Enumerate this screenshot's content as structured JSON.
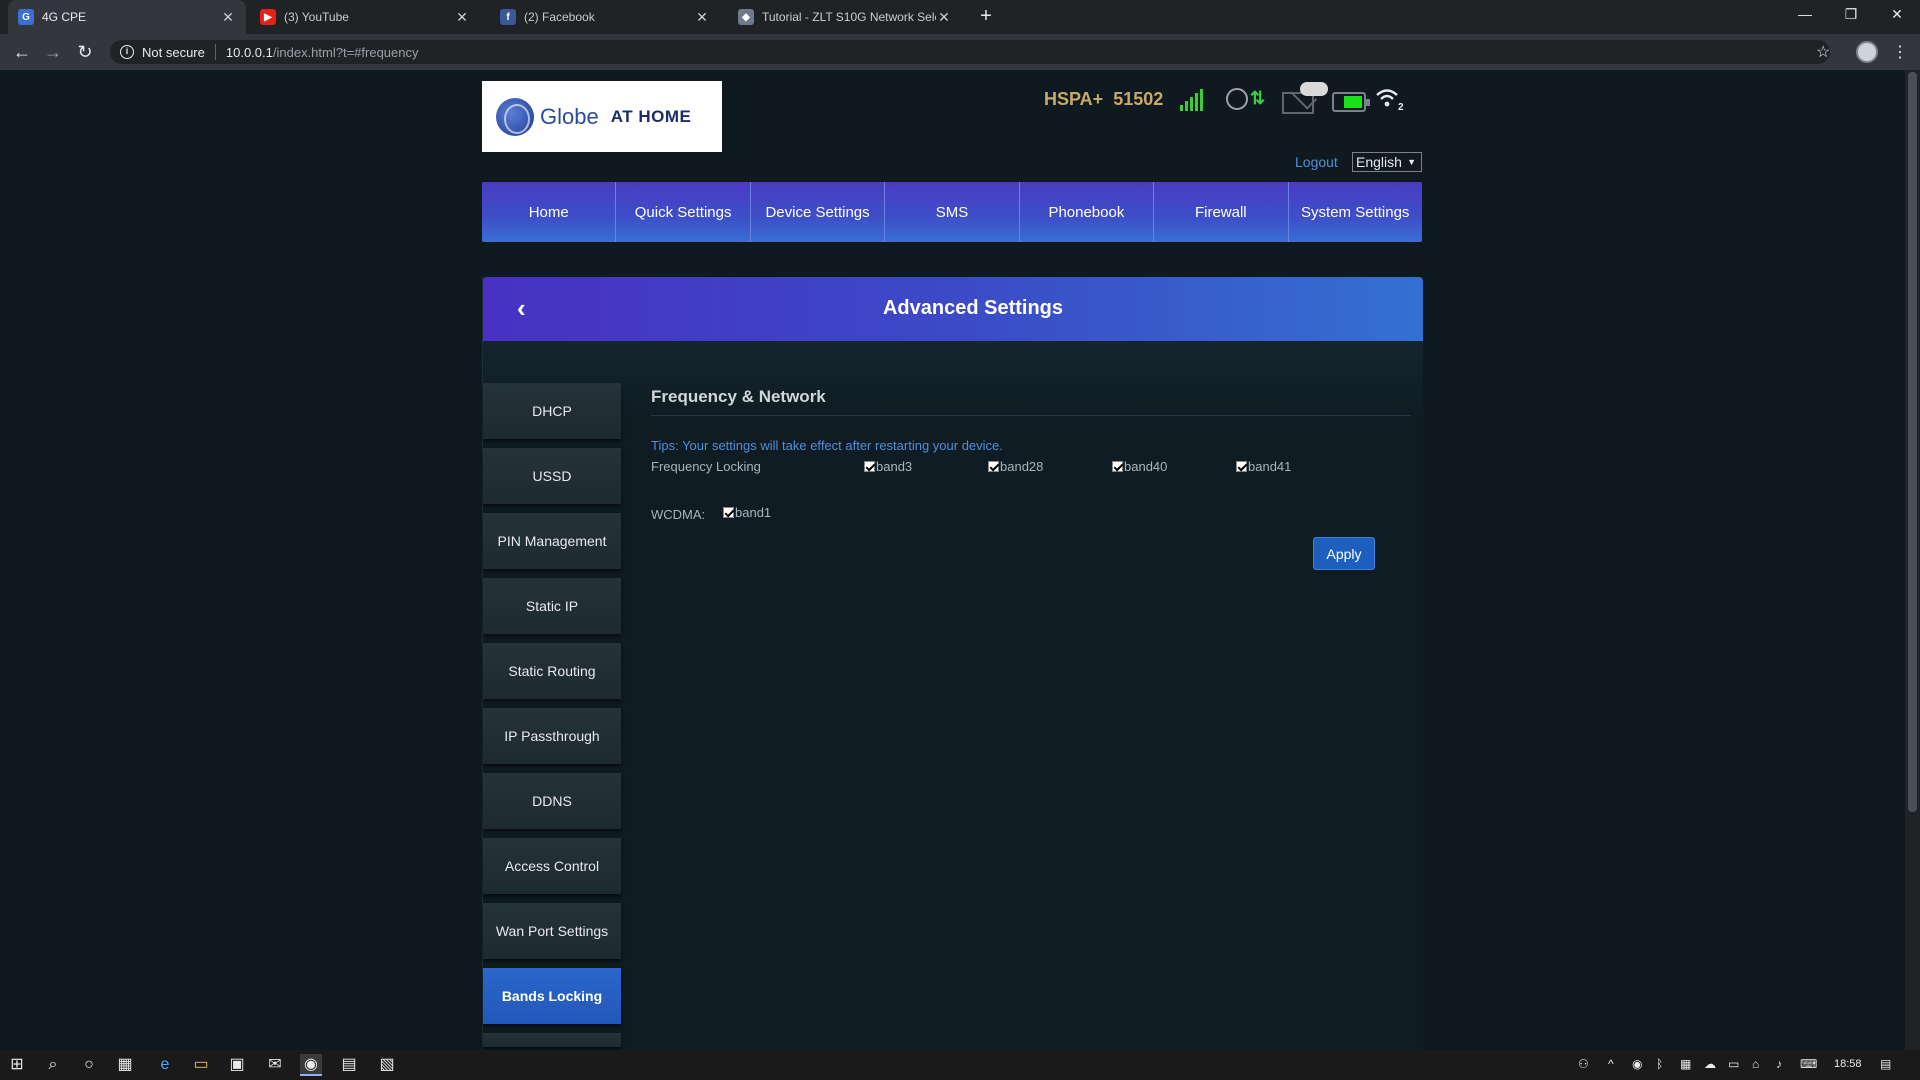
{
  "browser": {
    "tabs": [
      {
        "title": "4G CPE",
        "icon": "globe-favicon",
        "active": true
      },
      {
        "title": "(3) YouTube",
        "icon": "youtube-favicon",
        "active": false
      },
      {
        "title": "(2) Facebook",
        "icon": "facebook-favicon",
        "active": false
      },
      {
        "title": "Tutorial - ZLT S10G Network Sele",
        "icon": "shield-favicon",
        "active": false
      }
    ],
    "security_label": "Not secure",
    "url_host": "10.0.0.1",
    "url_path": "/index.html?t=#frequency"
  },
  "header": {
    "logo_brand": "Globe",
    "logo_tagline": "AT HOME",
    "network_label": "HSPA+",
    "operator_code": "51502",
    "wifi_clients": "2",
    "logout": "Logout",
    "language": "English"
  },
  "nav": {
    "items": [
      "Home",
      "Quick Settings",
      "Device Settings",
      "SMS",
      "Phonebook",
      "Firewall",
      "System Settings"
    ]
  },
  "panel": {
    "title": "Advanced Settings",
    "sidebar": [
      "DHCP",
      "USSD",
      "PIN Management",
      "Static IP",
      "Static Routing",
      "IP Passthrough",
      "DDNS",
      "Access Control",
      "Wan Port Settings",
      "Bands Locking"
    ],
    "active_item": "Bands Locking"
  },
  "content": {
    "section_title": "Frequency & Network",
    "tips": "Tips: Your settings will take effect after restarting your device.",
    "frequency_locking_label": "Frequency Locking",
    "lte_bands": [
      {
        "label": "band3",
        "checked": true
      },
      {
        "label": "band28",
        "checked": true
      },
      {
        "label": "band40",
        "checked": true
      },
      {
        "label": "band41",
        "checked": true
      }
    ],
    "wcdma_label": "WCDMA:",
    "wcdma_bands": [
      {
        "label": "band1",
        "checked": true
      }
    ],
    "apply_label": "Apply"
  },
  "taskbar": {
    "clock": "18:58"
  },
  "colors": {
    "nav_gradient_start": "#4a3bc1",
    "nav_gradient_end": "#3b6fd4",
    "active_menu": "#2a66cc",
    "link": "#4f8fd8",
    "signal_green": "#3ccd3c",
    "operator_text": "#c9a96a"
  }
}
